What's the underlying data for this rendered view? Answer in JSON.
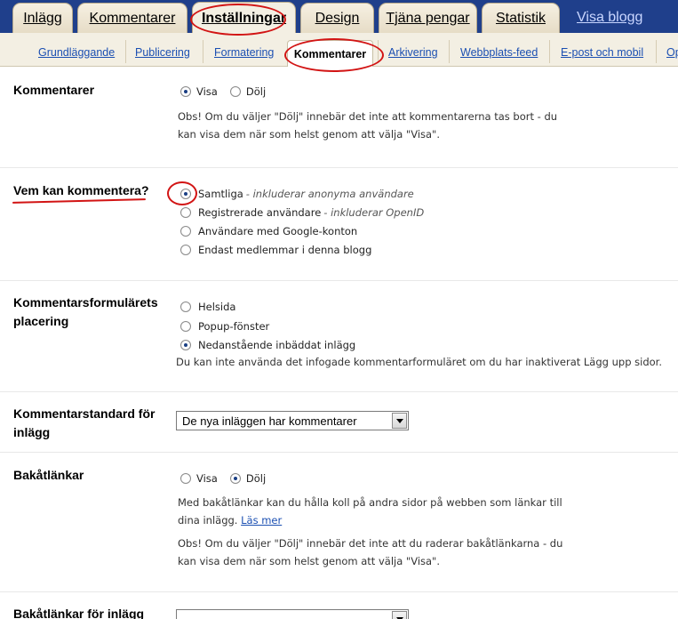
{
  "top_tabs": [
    {
      "label": "Inlägg"
    },
    {
      "label": "Kommentarer"
    },
    {
      "label": "Inställningar"
    },
    {
      "label": "Design"
    },
    {
      "label": "Tjäna pengar"
    },
    {
      "label": "Statistik"
    }
  ],
  "view_blog_link": "Visa blogg",
  "sub_tabs": [
    {
      "label": "Grundläggande"
    },
    {
      "label": "Publicering"
    },
    {
      "label": "Formatering"
    },
    {
      "label": "Kommentarer"
    },
    {
      "label": "Arkivering"
    },
    {
      "label": "Webbplats-feed"
    },
    {
      "label": "E-post och mobil"
    },
    {
      "label": "Op"
    }
  ],
  "sections": {
    "comments": {
      "label": "Kommentarer",
      "options": [
        {
          "label": "Visa",
          "selected": true
        },
        {
          "label": "Dölj",
          "selected": false
        }
      ],
      "note_line1": "Obs! Om du väljer \"Dölj\" innebär det inte att kommentarerna tas bort - du",
      "note_line2": "kan visa dem när som helst genom att välja \"Visa\"."
    },
    "who_can_comment": {
      "label": "Vem kan kommentera?",
      "options": [
        {
          "label": "Samtliga",
          "hint": "- inkluderar anonyma användare",
          "selected": true
        },
        {
          "label": "Registrerade användare",
          "hint": "- inkluderar OpenID",
          "selected": false
        },
        {
          "label": "Användare med Google-konton",
          "hint": "",
          "selected": false
        },
        {
          "label": "Endast medlemmar i denna blogg",
          "hint": "",
          "selected": false
        }
      ]
    },
    "form_placement": {
      "label_line1": "Kommentarsformulärets",
      "label_line2": "placering",
      "options": [
        {
          "label": "Helsida",
          "selected": false
        },
        {
          "label": "Popup-fönster",
          "selected": false
        },
        {
          "label": "Nedanstående inbäddat inlägg",
          "selected": true
        }
      ],
      "note": "Du kan inte använda det infogade kommentarformuläret om du har inaktiverat Lägg upp sidor."
    },
    "default_for_posts": {
      "label_line1": "Kommentarstandard för",
      "label_line2": "inlägg",
      "selected_value": "De nya inläggen har kommentarer"
    },
    "backlinks": {
      "label": "Bakåtlänkar",
      "options": [
        {
          "label": "Visa",
          "selected": false
        },
        {
          "label": "Dölj",
          "selected": true
        }
      ],
      "note_line1": "Med bakåtlänkar kan du hålla koll på andra sidor på webben som länkar till",
      "note_line2": "dina inlägg.",
      "learn_more": "Läs mer",
      "note_line3": "Obs! Om du väljer \"Dölj\" innebär det inte att du raderar bakåtlänkarna - du",
      "note_line4": "kan visa dem när som helst genom att välja \"Visa\"."
    },
    "backlinks_for_posts": {
      "label": "Bakåtlänkar för inlägg"
    }
  },
  "colors": {
    "top_bar": "#1f3f8b",
    "tab_bg": "#e6dcc6",
    "link": "#1b4fb2",
    "annotation_red": "#d21414"
  }
}
